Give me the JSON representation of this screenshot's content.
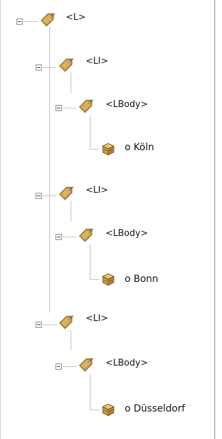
{
  "tree": {
    "root": {
      "label": "<L>",
      "expanded": true
    },
    "items": [
      {
        "label": "<LI>",
        "body": {
          "label": "<LBody>",
          "content": {
            "label": "o Köln"
          }
        }
      },
      {
        "label": "<LI>",
        "body": {
          "label": "<LBody>",
          "content": {
            "label": "o Bonn"
          }
        }
      },
      {
        "label": "<LI>",
        "body": {
          "label": "<LBody>",
          "content": {
            "label": "o Düsseldorf"
          }
        }
      }
    ]
  },
  "icons": {
    "tag": "tag-icon",
    "content": "content-box-icon",
    "toggle": "collapse-icon"
  },
  "colors": {
    "tag_fill": "#c79a3e",
    "tag_dark": "#8a6420",
    "box_fill": "#d9b36a",
    "box_dark": "#7a5a22",
    "tree_line": "#c2c2c2"
  }
}
